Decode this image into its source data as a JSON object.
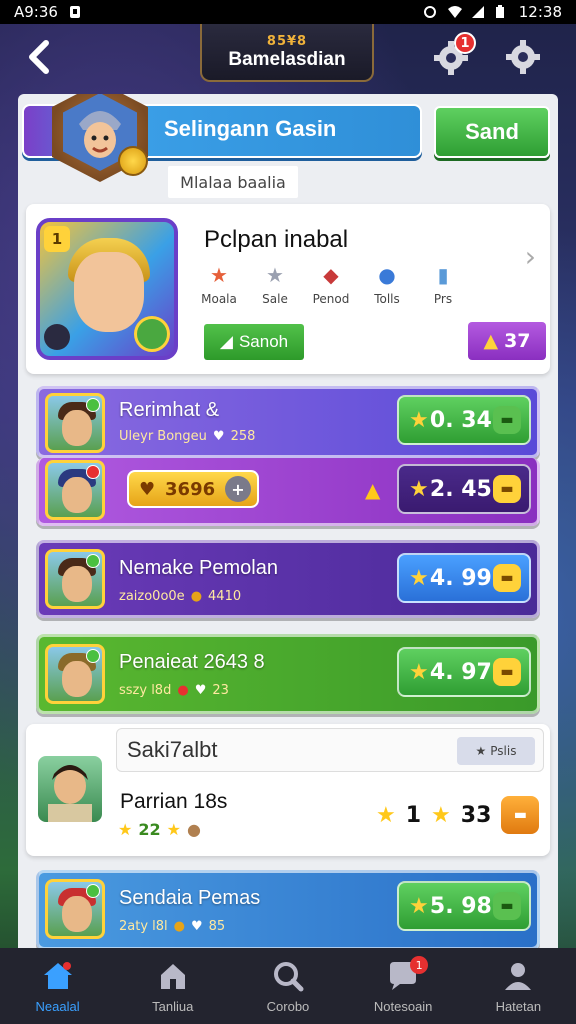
{
  "status_bar": {
    "time_left": "A9:36",
    "time_right": "12:38"
  },
  "header": {
    "title": "Bamelasdian",
    "emblem": "85¥8",
    "notification_count": "1"
  },
  "profile": {
    "name": "Selingann Gasin",
    "send_label": "Sand",
    "subtitle": "Mlalaa baalia"
  },
  "featured": {
    "level": "1",
    "title": "Pclpan inabal",
    "stats": [
      {
        "icon": "star-icon",
        "label": "Moala"
      },
      {
        "icon": "silver-star-icon",
        "label": "Sale"
      },
      {
        "icon": "meat-icon",
        "label": "Penod"
      },
      {
        "icon": "pills-icon",
        "label": "Tolls"
      },
      {
        "icon": "jar-icon",
        "label": "Prs"
      }
    ],
    "search_label": "Sanoh",
    "score": "37"
  },
  "rows": [
    {
      "name": "Rerimhat &",
      "meta": "Uleyr Bongeu",
      "meta_value": "258",
      "rating": "0. 34",
      "color": "#6b52d8"
    },
    {
      "coins": "3696",
      "rating": "2. 45",
      "color": "#9a3fc8"
    },
    {
      "name": "Nemake Pemolan",
      "meta": "zaizo0o0e",
      "meta_value": "4410",
      "rating": "4. 99",
      "color": "#5a2fa0"
    },
    {
      "name": "Penaieat 2643 8",
      "meta": "sszy l8d",
      "meta_value": "23",
      "rating": "4. 97",
      "color": "#3a9a2a"
    },
    {
      "name": "Sendaia Pemas",
      "meta": "2aty l8l",
      "meta_value": "85",
      "rating": "5. 98",
      "color": "#3a7ac8"
    }
  ],
  "white_card": {
    "title": "Saki7albt",
    "tag": "Pslis",
    "name": "Parrian 18s",
    "meta": "22",
    "rating_a": "1",
    "rating_b": "33"
  },
  "bottom_nav": [
    {
      "label": "Neaalal",
      "icon": "home-icon",
      "active": true
    },
    {
      "label": "Tanliua",
      "icon": "house-icon",
      "active": false
    },
    {
      "label": "Corobo",
      "icon": "search-icon",
      "active": false
    },
    {
      "label": "Notesoain",
      "icon": "chat-icon",
      "active": false,
      "badge": "1"
    },
    {
      "label": "Hatetan",
      "icon": "profile-icon",
      "active": false
    }
  ]
}
